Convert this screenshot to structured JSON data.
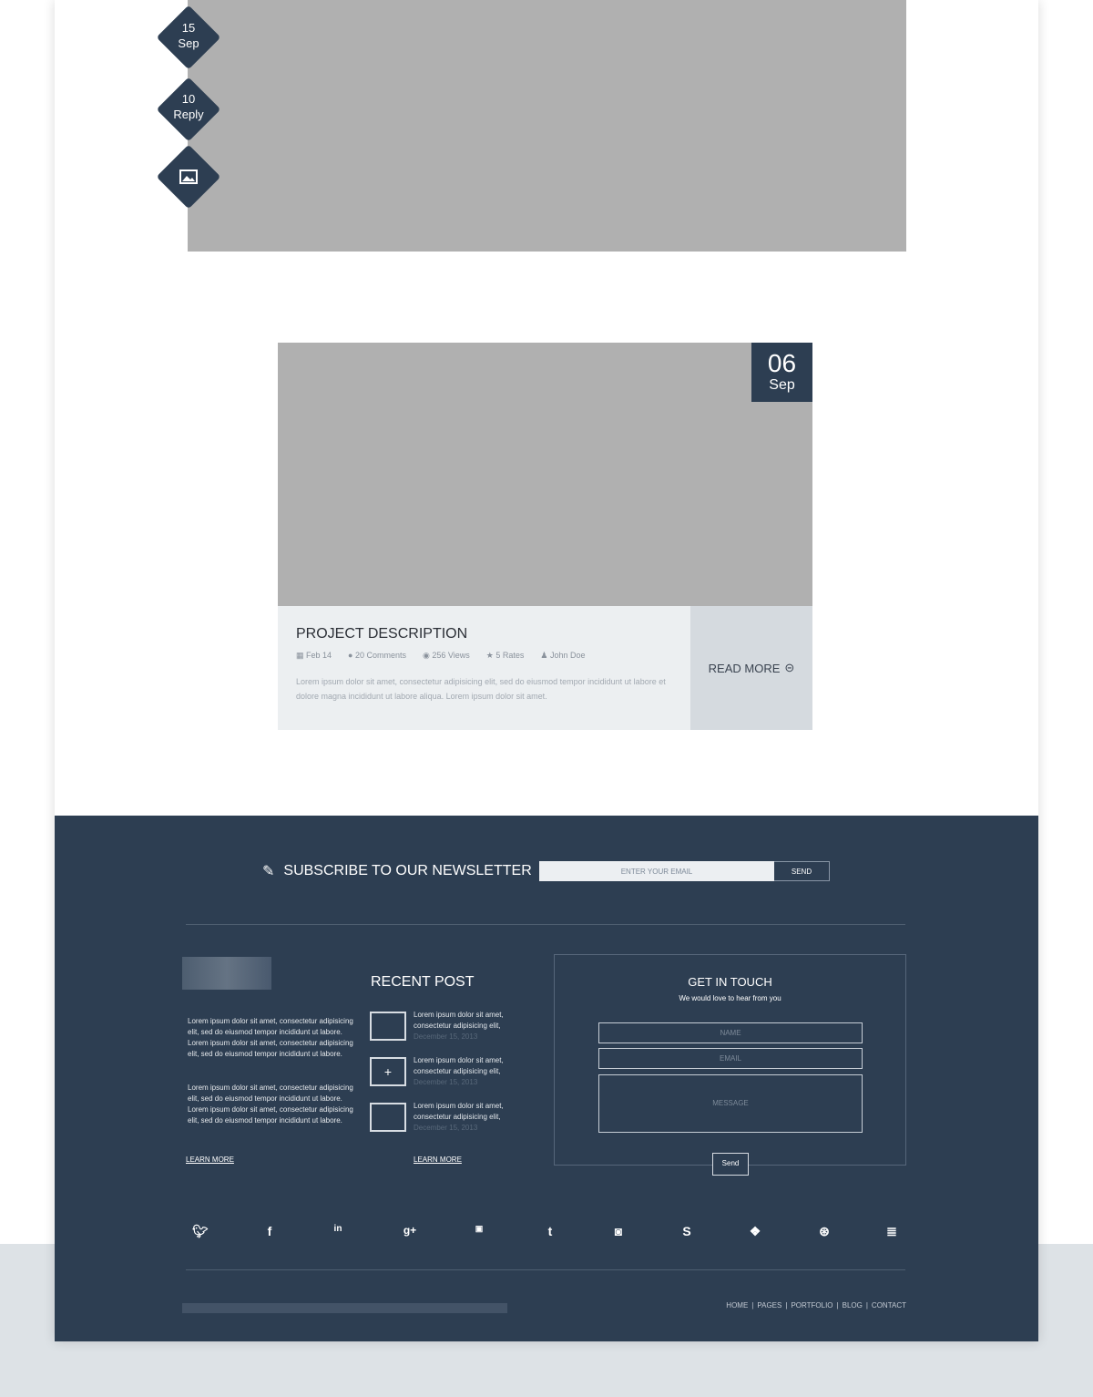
{
  "post1": {
    "day": "15",
    "month": "Sep",
    "replies": "10",
    "reply_label": "Reply",
    "icon": "image-icon"
  },
  "post2": {
    "day": "06",
    "month": "Sep",
    "title": "PROJECT DESCRIPTION",
    "meta": [
      {
        "icon": "calendar-icon",
        "text": "Feb 14"
      },
      {
        "icon": "comment-icon",
        "text": "20 Comments"
      },
      {
        "icon": "eye-icon",
        "text": "256 Views"
      },
      {
        "icon": "star-icon",
        "text": "5 Rates"
      },
      {
        "icon": "user-icon",
        "text": "John Doe"
      }
    ],
    "excerpt": "Lorem ipsum dolor sit amet, consectetur adipisicing elit, sed do eiusmod tempor incididunt ut labore et  dolore magna incididunt ut labore aliqua. Lorem ipsum dolor sit amet.",
    "read_more": "READ MORE"
  },
  "newsletter": {
    "title": "SUBSCRIBE TO OUR NEWSLETTER",
    "placeholder": "ENTER YOUR EMAIL",
    "send": "SEND"
  },
  "about": {
    "p1": "Lorem ipsum dolor sit amet, consectetur adipisicing elit, sed do eiusmod tempor incididunt ut labore. Lorem ipsum dolor sit amet, consectetur adipisicing elit, sed do eiusmod tempor incididunt ut labore.",
    "p2": "Lorem ipsum dolor sit amet, consectetur adipisicing elit, sed do eiusmod tempor incididunt ut labore. Lorem ipsum dolor sit amet, consectetur adipisicing elit, sed do eiusmod tempor incididunt ut labore.",
    "learn_more": "LEARN MORE"
  },
  "recent": {
    "title": "RECENT POST",
    "items": [
      {
        "text": "Lorem ipsum dolor sit amet, consectetur adipisicing elit,",
        "date": "December 15, 2013"
      },
      {
        "text": "Lorem ipsum dolor sit amet, consectetur adipisicing elit,",
        "date": "December 15, 2013"
      },
      {
        "text": "Lorem ipsum dolor sit amet, consectetur adipisicing elit,",
        "date": "December 15, 2013"
      }
    ],
    "learn_more": "LEARN MORE"
  },
  "contact": {
    "title": "GET IN TOUCH",
    "subtitle": "We would love to hear from you",
    "name": "NAME",
    "email": "EMAIL",
    "message": "MESSAGE",
    "send": "Send"
  },
  "social": [
    "twitter",
    "facebook",
    "linkedin",
    "google-plus",
    "youtube",
    "tumblr",
    "rss",
    "skype",
    "dropbox",
    "dribbble",
    "stack-overflow"
  ],
  "nav": [
    "HOME",
    "PAGES",
    "PORTFOLIO",
    "BLOG",
    "CONTACT"
  ],
  "colors": {
    "dark": "#2d3e52",
    "image_placeholder": "#b0b0b0"
  }
}
